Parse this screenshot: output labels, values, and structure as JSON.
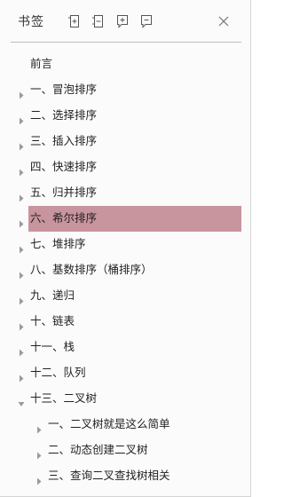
{
  "panel": {
    "title": "书签",
    "toolbar": [
      {
        "icon": "expand-all-icon"
      },
      {
        "icon": "collapse-all-icon"
      },
      {
        "icon": "add-bookmark-icon"
      },
      {
        "icon": "bookmark-options-icon"
      }
    ],
    "close_icon": "close-icon"
  },
  "colors": {
    "selected_bg": "#c8949e",
    "divider": "#bdbdbd",
    "arrow": "#9a9a9a"
  },
  "bookmarks": [
    {
      "label": "前言",
      "level": 0,
      "arrow": "none"
    },
    {
      "label": "一、冒泡排序",
      "level": 0,
      "arrow": "right"
    },
    {
      "label": "二、选择排序",
      "level": 0,
      "arrow": "right"
    },
    {
      "label": "三、插入排序",
      "level": 0,
      "arrow": "right"
    },
    {
      "label": "四、快速排序",
      "level": 0,
      "arrow": "right"
    },
    {
      "label": "五、归并排序",
      "level": 0,
      "arrow": "right"
    },
    {
      "label": "六、希尔排序",
      "level": 0,
      "arrow": "right",
      "selected": true
    },
    {
      "label": "七、堆排序",
      "level": 0,
      "arrow": "right"
    },
    {
      "label": "八、基数排序（桶排序）",
      "level": 0,
      "arrow": "right"
    },
    {
      "label": "九、递归",
      "level": 0,
      "arrow": "right"
    },
    {
      "label": "十、链表",
      "level": 0,
      "arrow": "right"
    },
    {
      "label": "十一、栈",
      "level": 0,
      "arrow": "right"
    },
    {
      "label": "十二、队列",
      "level": 0,
      "arrow": "right"
    },
    {
      "label": "十三、二叉树",
      "level": 0,
      "arrow": "down"
    },
    {
      "label": "一、二叉树就是这么简单",
      "level": 1,
      "arrow": "right"
    },
    {
      "label": "二、动态创建二叉树",
      "level": 1,
      "arrow": "right"
    },
    {
      "label": "三、查询二叉查找树相关",
      "level": 1,
      "arrow": "right"
    }
  ]
}
